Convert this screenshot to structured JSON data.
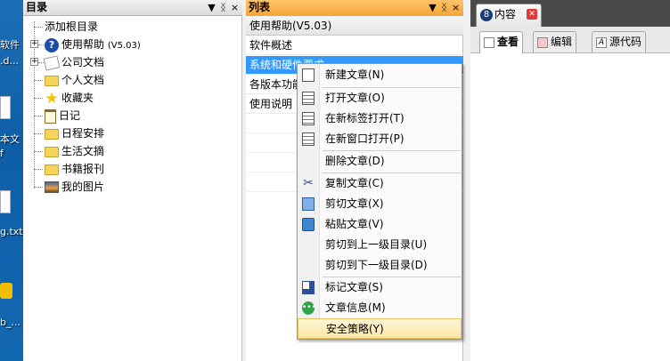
{
  "desktop": {
    "labels": [
      "软件",
      ".d...",
      "本文",
      "f",
      "g.txt",
      "b_..."
    ]
  },
  "tree_panel": {
    "title": "目录",
    "header_buttons": [
      "▼",
      "ᛝ",
      "×"
    ],
    "items": [
      {
        "label": "添加根目录",
        "icon": "none"
      },
      {
        "label": "使用帮助",
        "suffix": "(V5.03)",
        "icon": "help-icon"
      },
      {
        "label": "公司文档",
        "icon": "document-icon"
      },
      {
        "label": "个人文档",
        "icon": "folder-icon"
      },
      {
        "label": "收藏夹",
        "icon": "star-icon"
      },
      {
        "label": "日记",
        "icon": "clipboard-icon"
      },
      {
        "label": "日程安排",
        "icon": "folder-icon"
      },
      {
        "label": "生活文摘",
        "icon": "folder-icon"
      },
      {
        "label": "书籍报刊",
        "icon": "folder-icon"
      },
      {
        "label": "我的图片",
        "icon": "picture-icon"
      }
    ]
  },
  "list_panel": {
    "title": "列表",
    "header_buttons": [
      "▼",
      "ᛝ",
      "×"
    ],
    "subheader": "使用帮助(V5.03)",
    "items": [
      "软件概述",
      "系统和硬件要求",
      "各版本功能",
      "使用说明"
    ]
  },
  "content_panel": {
    "tab_number": "8",
    "tab_label": "内容",
    "view_tabs": [
      "查看",
      "编辑",
      "源代码"
    ]
  },
  "context_menu": {
    "items": [
      {
        "label": "新建文章(N)",
        "icon": "new-page-icon"
      },
      {
        "label": "打开文章(O)",
        "icon": "open-page-icon"
      },
      {
        "label": "在新标签打开(T)",
        "icon": "new-tab-icon"
      },
      {
        "label": "在新窗口打开(P)",
        "icon": "new-window-icon"
      },
      {
        "label": "删除文章(D)",
        "icon": "none"
      },
      {
        "label": "复制文章(C)",
        "icon": "scissors-icon"
      },
      {
        "label": "剪切文章(X)",
        "icon": "copy-icon"
      },
      {
        "label": "粘贴文章(V)",
        "icon": "paste-icon"
      },
      {
        "label": "剪切到上一级目录(U)",
        "icon": "none"
      },
      {
        "label": "剪切到下一级目录(D)",
        "icon": "none"
      },
      {
        "label": "标记文章(S)",
        "icon": "mark-icon"
      },
      {
        "label": "文章信息(M)",
        "icon": "info-icon"
      },
      {
        "label": "安全策略(Y)",
        "icon": "none"
      }
    ]
  },
  "colors": {
    "active_header": "#f6a63a",
    "selection": "#3399ff",
    "menu_hover": "#fde7a6"
  }
}
